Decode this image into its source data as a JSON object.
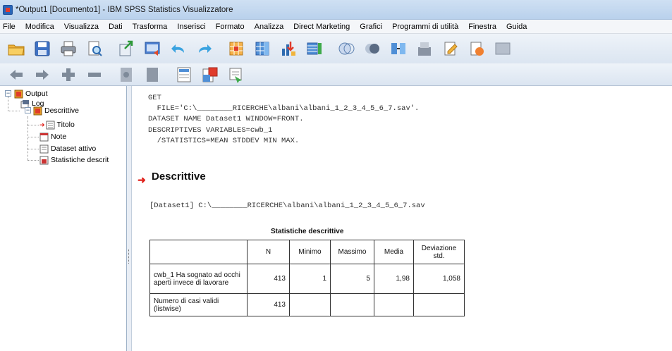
{
  "window": {
    "title": "*Output1 [Documento1] - IBM SPSS Statistics Visualizzatore"
  },
  "menu": [
    "File",
    "Modifica",
    "Visualizza",
    "Dati",
    "Trasforma",
    "Inserisci",
    "Formato",
    "Analizza",
    "Direct Marketing",
    "Grafici",
    "Programmi di utilità",
    "Finestra",
    "Guida"
  ],
  "toolbar1_icons": [
    "open-folder-icon",
    "save-icon",
    "print-icon",
    "print-preview-icon",
    "export-icon",
    "goto-data-icon",
    "undo-icon",
    "redo-icon",
    "goto-case-icon",
    "goto-variable-icon",
    "variables-icon",
    "insert-output-icon",
    "designate-window-icon",
    "split-file-icon",
    "weight-cases-icon",
    "select-cases-icon",
    "value-labels-icon",
    "scripting-icon",
    "use-sets-icon",
    "show-all-variables-icon"
  ],
  "toolbar2_icons": [
    "promote-icon",
    "demote-icon",
    "expand-icon",
    "collapse-icon",
    "show-icon",
    "hide-icon",
    "insert-heading-icon",
    "insert-title-icon",
    "insert-text-icon"
  ],
  "navigator": {
    "items": [
      {
        "label": "Output",
        "icon": "output-book-icon"
      },
      {
        "label": "Log",
        "icon": "log-icon"
      },
      {
        "label": "Descrittive",
        "icon": "book-icon"
      },
      {
        "label": "Titolo",
        "icon": "title-icon"
      },
      {
        "label": "Note",
        "icon": "note-icon"
      },
      {
        "label": "Dataset attivo",
        "icon": "dataset-icon"
      },
      {
        "label": "Statistiche descrit",
        "icon": "table-icon"
      }
    ],
    "expander": "−"
  },
  "content": {
    "syntax": "GET\n  FILE='C:\\________RICERCHE\\albani\\albani_1_2_3_4_5_6_7.sav'.\nDATASET NAME Dataset1 WINDOW=FRONT.\nDESCRIPTIVES VARIABLES=cwb_1\n  /STATISTICS=MEAN STDDEV MIN MAX.",
    "section_title": "Descrittive",
    "dataset_line": "[Dataset1] C:\\________RICERCHE\\albani\\albani_1_2_3_4_5_6_7.sav",
    "table": {
      "title": "Statistiche descrittive",
      "headers": [
        "",
        "N",
        "Minimo",
        "Massimo",
        "Media",
        "Deviazione std."
      ],
      "rows": [
        [
          "cwb_1 Ha sognato ad occhi aperti invece di lavorare",
          "413",
          "1",
          "5",
          "1,98",
          "1,058"
        ],
        [
          "Numero di casi validi (listwise)",
          "413",
          "",
          "",
          "",
          ""
        ]
      ]
    }
  },
  "colors": {
    "accent_arrow": "#e0201a",
    "titlebar": "#cfe0f3",
    "toolbar": "#dbe5f1"
  }
}
